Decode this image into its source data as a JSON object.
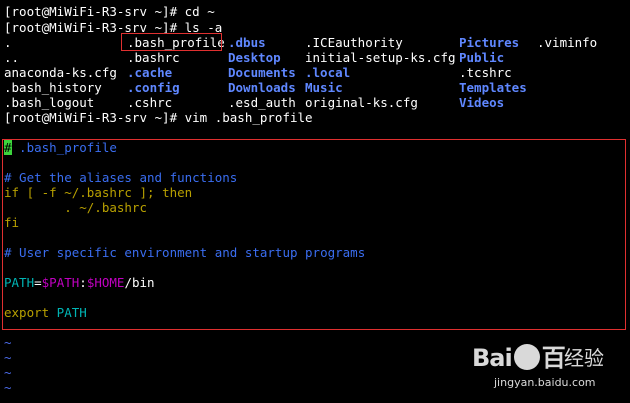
{
  "terminal": {
    "lines": [
      "[root@MiWiFi-R3-srv ~]# cd ~",
      "[root@MiWiFi-R3-srv ~]# ls -a",
      "[root@MiWiFi-R3-srv ~]# vim .bash_profile"
    ],
    "ls_rows": [
      [
        ".",
        ".bash_profile",
        ".dbus",
        ".ICEauthority",
        "Pictures",
        ".viminfo"
      ],
      [
        "..",
        ".bashrc",
        "Desktop",
        "initial-setup-ks.cfg",
        "Public",
        ""
      ],
      [
        "anaconda-ks.cfg",
        ".cache",
        "Documents",
        ".local",
        ".tcshrc",
        ""
      ],
      [
        ".bash_history",
        ".config",
        "Downloads",
        "Music",
        "Templates",
        ""
      ],
      [
        ".bash_logout",
        ".cshrc",
        ".esd_auth",
        "original-ks.cfg",
        "Videos",
        ""
      ]
    ]
  },
  "vim": {
    "cursor_char": "#",
    "l1_rest": " .bash_profile",
    "l3": "# Get the aliases and functions",
    "l4_if": "if",
    "l4_mid": " [ -f ~/.bashrc ]; ",
    "l4_then": "then",
    "l5": "        . ~/.bashrc",
    "l6": "fi",
    "l8": "# User specific environment and startup programs",
    "l10_a": "PATH",
    "l10_b": "=",
    "l10_c": "$PATH",
    "l10_d": ":",
    "l10_e": "$HOME",
    "l10_f": "/bin",
    "l12_a": "export",
    "l12_b": " PATH",
    "tilde": "~"
  },
  "watermark": {
    "logo_left": "Bai",
    "logo_right": "百",
    "cn": "经验",
    "url": "jingyan.baidu.com"
  },
  "colors": {
    "directory": "#5f87ff",
    "comment": "#3a6df0",
    "keyword": "#b8a000",
    "variable": "#c000c0",
    "highlight_box": "#e03030",
    "cursor": "#3cd43c"
  }
}
